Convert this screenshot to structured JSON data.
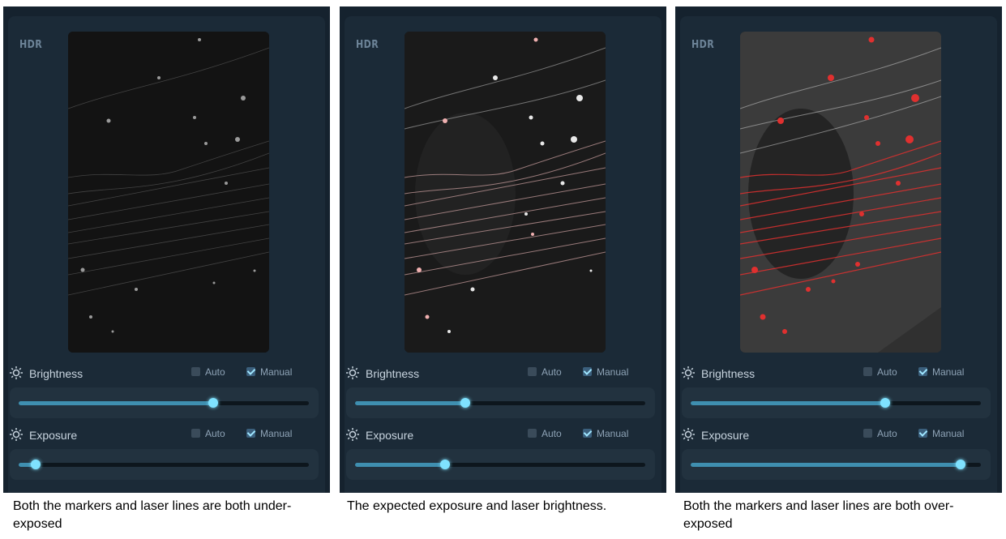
{
  "panels": [
    {
      "hdr": "HDR",
      "brightness": {
        "label": "Brightness",
        "auto": "Auto",
        "manual": "Manual",
        "value": 0.67
      },
      "exposure": {
        "label": "Exposure",
        "auto": "Auto",
        "manual": "Manual",
        "value": 0.06
      },
      "caption": "Both the markers and laser lines are both under-exposed"
    },
    {
      "hdr": "HDR",
      "brightness": {
        "label": "Brightness",
        "auto": "Auto",
        "manual": "Manual",
        "value": 0.38
      },
      "exposure": {
        "label": "Exposure",
        "auto": "Auto",
        "manual": "Manual",
        "value": 0.31
      },
      "caption": "The expected exposure and laser brightness."
    },
    {
      "hdr": "HDR",
      "brightness": {
        "label": "Brightness",
        "auto": "Auto",
        "manual": "Manual",
        "value": 0.67
      },
      "exposure": {
        "label": "Exposure",
        "auto": "Auto",
        "manual": "Manual",
        "value": 0.93
      },
      "caption": "Both the markers and laser lines are both over-exposed"
    }
  ],
  "colors": {
    "accent": "#7fe2ff",
    "panel_bg": "#1b2a37",
    "track_fill": "#3f8fb0",
    "laser_red": "#e0302f"
  },
  "icons": {
    "setting": "sun-gear-icon",
    "checkbox": "checkbox-icon"
  }
}
